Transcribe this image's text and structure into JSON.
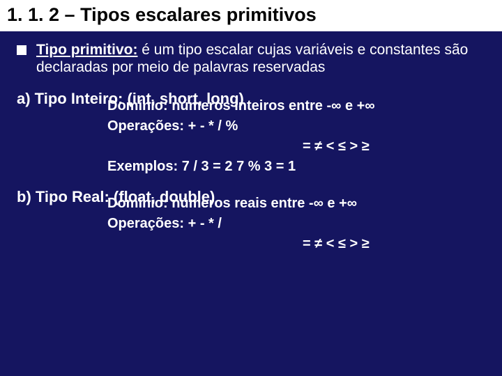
{
  "title": "1. 1. 2 – Tipos escalares primitivos",
  "intro": {
    "lead": "Tipo primitivo:",
    "rest": " é um tipo escalar cujas variáveis e constantes são declaradas por meio de palavras reservadas"
  },
  "sectionA": {
    "heading": "a) Tipo Inteiro: (int, short, long)",
    "domain": "Domínio: números inteiros entre  -∞   e   +∞",
    "ops": "Operações:   +   -   *   /   %",
    "rel": "=  ≠  <  ≤  >  ≥",
    "ex": "Exemplos:    7  /  3  =  2           7  %  3 = 1"
  },
  "sectionB": {
    "heading": "b) Tipo Real: (float, double)",
    "domain": "Domínio: números reais entre  -∞   e   +∞",
    "ops": "Operações:   +   -   *   /",
    "rel": "=  ≠  <  ≤  >  ≥"
  }
}
